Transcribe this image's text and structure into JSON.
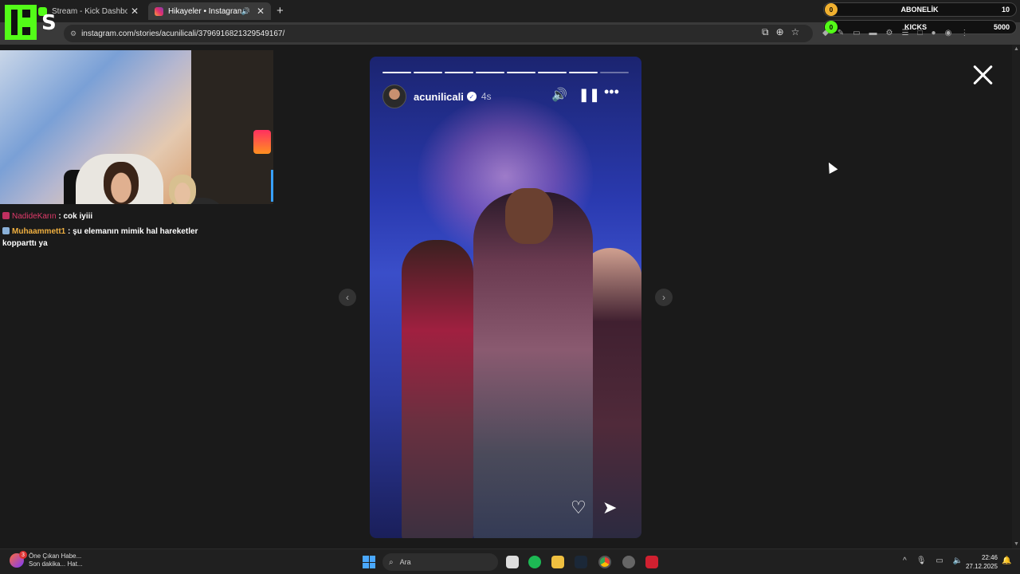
{
  "browser": {
    "tabs": [
      {
        "title": "Stream - Kick Dashboard",
        "active": false,
        "close": "✕"
      },
      {
        "title": "Hikayeler • Instagram",
        "active": true,
        "close": "✕"
      }
    ],
    "new_tab": "+",
    "url": "instagram.com/stories/acunilicali/3796916821329549167/"
  },
  "overlay": {
    "abonelik": {
      "label": "ABONELİK",
      "count": "0",
      "value": "10"
    },
    "kicks": {
      "label": "KICKS",
      "count": "0",
      "value": "5000"
    }
  },
  "chat": {
    "messages": [
      {
        "user": "NadideKarın",
        "text": ": cok iyiii"
      },
      {
        "user": "Muhaammett1",
        "text": ": şu elemanın mimik hal hareketler kopparttı ya"
      }
    ]
  },
  "story": {
    "username": "acunilicali",
    "time": "4s",
    "segments_total": 8,
    "segments_done": 7
  },
  "taskbar": {
    "news_title": "Öne Çıkan Habe...",
    "news_sub": "Son dakika... Hat...",
    "news_badge": "3",
    "search_placeholder": "Ara",
    "time": "22:46",
    "date": "27.12.2025"
  },
  "colors": {
    "kick_green": "#53fc18",
    "accent_blue": "#4aa8ff"
  }
}
